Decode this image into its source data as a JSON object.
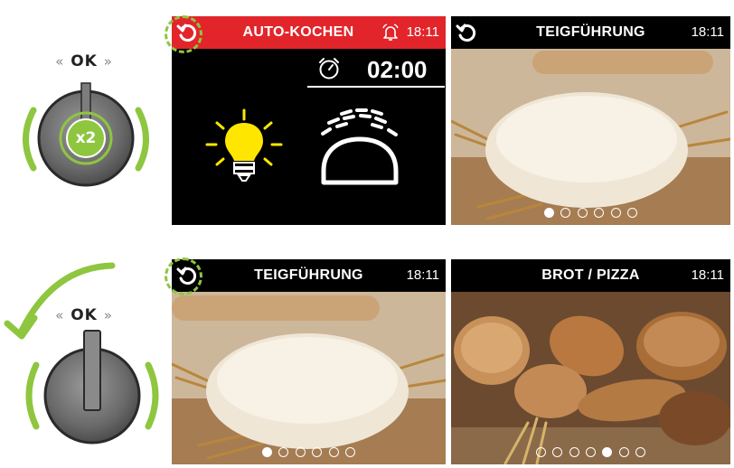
{
  "knob_top": {
    "label_left": "«",
    "label_ok": "OK",
    "label_right": "»",
    "badge": "x2"
  },
  "knob_bottom": {
    "label_left": "«",
    "label_ok": "OK",
    "label_right": "»"
  },
  "screen_auto": {
    "title": "AUTO-KOCHEN",
    "time": "18:11",
    "timer": "02:00"
  },
  "screen_tf_top": {
    "title": "TEIGFÜHRUNG",
    "time": "18:11",
    "page_active": 1,
    "page_count": 6
  },
  "screen_tf_bottom": {
    "title": "TEIGFÜHRUNG",
    "time": "18:11",
    "page_active": 1,
    "page_count": 6
  },
  "screen_brot": {
    "title": "BROT / PIZZA",
    "time": "18:11",
    "page_active": 5,
    "page_count": 7
  },
  "colors": {
    "accent_green": "#8ec63f",
    "header_red": "#e2252b",
    "bulb_yellow": "#ffe600"
  }
}
